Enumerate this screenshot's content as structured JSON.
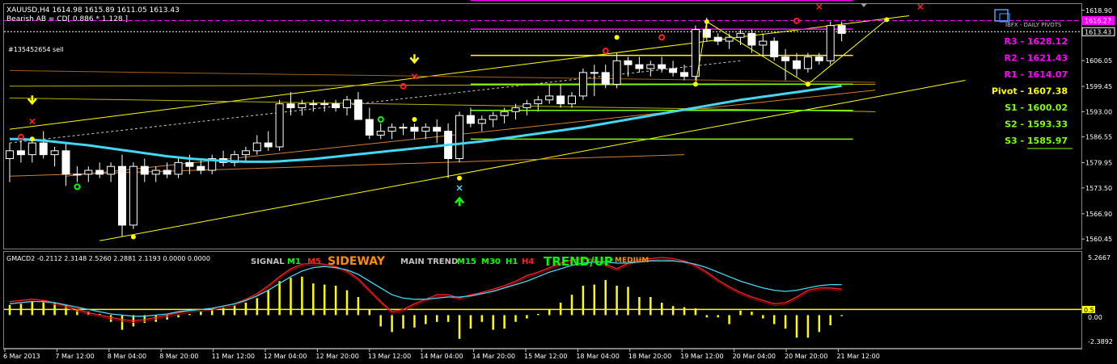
{
  "header": {
    "symbol_line": "XAUUSD,H4  1614.98 1615.89 1611.05 1613.43",
    "pattern_line": "Bearish AB = CD[ 0.886 * 1.128 ]",
    "order_label": "#135452654 sell",
    "pivots_caption": "IBFX - DAILY PIVOTS"
  },
  "pivots": [
    {
      "label": "R3 - 1628.12",
      "value": 1628.12,
      "color": "#ff00ff"
    },
    {
      "label": "R2 - 1621.43",
      "value": 1621.43,
      "color": "#ff00ff"
    },
    {
      "label": "R1 - 1614.07",
      "value": 1614.07,
      "color": "#ff00ff"
    },
    {
      "label": "Pivot - 1607.38",
      "value": 1607.38,
      "color": "#ffff00"
    },
    {
      "label": "S1 - 1600.02",
      "value": 1600.02,
      "color": "#7fff00"
    },
    {
      "label": "S2 - 1593.33",
      "value": 1593.33,
      "color": "#7fff00"
    },
    {
      "label": "S3 - 1585.97",
      "value": 1585.97,
      "color": "#7fff00"
    }
  ],
  "indicator": {
    "name_line": "GMACD2 -0.2112 2.3148 2.5260 2.2881 2.1193 0.0000 0.0000",
    "signal_label": "SIGNAL",
    "m1": "M1",
    "m5": "M5",
    "sideway": "SIDEWAY",
    "main_trend_label": "MAIN TREND",
    "m15": "M15",
    "m30": "M30",
    "h1": "H1",
    "h4": "H4",
    "trend_up": "TREND/UP",
    "medium": "MEDIUM"
  },
  "colors": {
    "bull": "#ffffff",
    "bear": "#ffffff",
    "ema": "#44d7f5",
    "grid": "#555555",
    "histogram": "#ffff00",
    "signal_red": "#ff2020",
    "signal_blue": "#44d7f5"
  },
  "chart_data": [
    {
      "type": "candlestick",
      "symbol": "XAUUSD",
      "timeframe": "H4",
      "ylim": [
        1558.0,
        1620.5
      ],
      "y_ticks": [
        "1618.90",
        "1613.43",
        "1606.05",
        "1599.45",
        "1593.00",
        "1586.55",
        "1579.95",
        "1573.50",
        "1566.90",
        "1560.45"
      ],
      "y_tick_values": [
        1618.9,
        1613.43,
        1606.05,
        1599.45,
        1593.0,
        1586.55,
        1579.95,
        1573.5,
        1566.9,
        1560.45
      ],
      "price_tags": [
        {
          "label": "1616.27",
          "value": 1616.27,
          "color": "#ff00ff"
        },
        {
          "label": "1613.43",
          "value": 1613.43,
          "color": "#ffffff"
        }
      ],
      "x_labels": [
        "6 Mar 2013",
        "7 Mar 12:00",
        "8 Mar 04:00",
        "8 Mar 20:00",
        "11 Mar 12:00",
        "12 Mar 04:00",
        "12 Mar 20:00",
        "13 Mar 12:00",
        "14 Mar 04:00",
        "14 Mar 20:00",
        "15 Mar 12:00",
        "18 Mar 04:00",
        "18 Mar 20:00",
        "19 Mar 12:00",
        "20 Mar 04:00",
        "20 Mar 20:00",
        "21 Mar 12:00"
      ],
      "candles": [
        [
          1581,
          1585,
          1575,
          1583
        ],
        [
          1583,
          1586,
          1580,
          1582
        ],
        [
          1582,
          1586,
          1580,
          1585
        ],
        [
          1585,
          1588,
          1581,
          1582
        ],
        [
          1582,
          1584,
          1579,
          1583
        ],
        [
          1583,
          1585,
          1574,
          1577
        ],
        [
          1577,
          1579,
          1575,
          1577
        ],
        [
          1577,
          1579,
          1575,
          1578
        ],
        [
          1578,
          1580,
          1576,
          1577
        ],
        [
          1577,
          1580,
          1575,
          1579
        ],
        [
          1579,
          1582,
          1561,
          1564
        ],
        [
          1564,
          1580,
          1563,
          1579
        ],
        [
          1579,
          1581,
          1575,
          1577
        ],
        [
          1577,
          1579,
          1575,
          1578
        ],
        [
          1578,
          1580,
          1576,
          1577
        ],
        [
          1577,
          1581,
          1576,
          1580
        ],
        [
          1580,
          1582,
          1577,
          1579
        ],
        [
          1579,
          1581,
          1577,
          1578
        ],
        [
          1578,
          1582,
          1577,
          1581
        ],
        [
          1581,
          1583,
          1579,
          1580
        ],
        [
          1580,
          1583,
          1579,
          1582
        ],
        [
          1582,
          1584,
          1580,
          1583
        ],
        [
          1583,
          1587,
          1582,
          1585
        ],
        [
          1585,
          1588,
          1583,
          1584
        ],
        [
          1584,
          1596,
          1583,
          1595
        ],
        [
          1595,
          1598,
          1592,
          1594
        ],
        [
          1594,
          1596,
          1592,
          1595
        ],
        [
          1595,
          1596,
          1593,
          1595
        ],
        [
          1595,
          1596,
          1593,
          1595
        ],
        [
          1595,
          1596,
          1593,
          1594
        ],
        [
          1594,
          1597,
          1592,
          1596
        ],
        [
          1596,
          1598,
          1591,
          1591
        ],
        [
          1591,
          1594,
          1586,
          1587
        ],
        [
          1587,
          1590,
          1586,
          1588
        ],
        [
          1588,
          1590,
          1586,
          1589
        ],
        [
          1589,
          1590,
          1587,
          1589
        ],
        [
          1589,
          1590,
          1586,
          1588
        ],
        [
          1588,
          1590,
          1586,
          1589
        ],
        [
          1589,
          1591,
          1585,
          1588
        ],
        [
          1588,
          1590,
          1576,
          1581
        ],
        [
          1581,
          1593,
          1580,
          1592
        ],
        [
          1592,
          1594,
          1589,
          1590
        ],
        [
          1590,
          1592,
          1588,
          1591
        ],
        [
          1591,
          1593,
          1589,
          1592
        ],
        [
          1592,
          1594,
          1590,
          1593
        ],
        [
          1593,
          1595,
          1591,
          1594
        ],
        [
          1594,
          1596,
          1592,
          1595
        ],
        [
          1595,
          1597,
          1593,
          1596
        ],
        [
          1596,
          1600,
          1595,
          1597
        ],
        [
          1597,
          1600,
          1594,
          1595
        ],
        [
          1595,
          1598,
          1594,
          1597
        ],
        [
          1597,
          1604,
          1596,
          1603
        ],
        [
          1603,
          1605,
          1597,
          1603
        ],
        [
          1603,
          1605,
          1599,
          1600
        ],
        [
          1600,
          1608,
          1599,
          1606
        ],
        [
          1606,
          1607,
          1602,
          1605
        ],
        [
          1605,
          1607,
          1603,
          1604
        ],
        [
          1604,
          1606,
          1602,
          1605
        ],
        [
          1605,
          1607,
          1603,
          1604
        ],
        [
          1604,
          1606,
          1602,
          1603
        ],
        [
          1603,
          1605,
          1601,
          1602
        ],
        [
          1602,
          1615,
          1601,
          1614
        ],
        [
          1614,
          1617,
          1611,
          1612
        ],
        [
          1612,
          1613,
          1610,
          1611
        ],
        [
          1611,
          1613,
          1609,
          1612
        ],
        [
          1612,
          1614,
          1610,
          1613
        ],
        [
          1613,
          1614,
          1608,
          1610
        ],
        [
          1610,
          1613,
          1607,
          1611
        ],
        [
          1611,
          1612,
          1606,
          1607
        ],
        [
          1607,
          1609,
          1601,
          1606
        ],
        [
          1606,
          1608,
          1602,
          1604
        ],
        [
          1604,
          1608,
          1603,
          1607
        ],
        [
          1607,
          1608,
          1605,
          1606
        ],
        [
          1606,
          1616,
          1605,
          1615
        ],
        [
          1615,
          1616,
          1611,
          1613
        ]
      ],
      "ema_values": [
        1586,
        1586,
        1585.8,
        1585.6,
        1585.3,
        1585,
        1584.7,
        1584.4,
        1584.0,
        1583.6,
        1583.2,
        1582.8,
        1582.4,
        1582.0,
        1581.6,
        1581.3,
        1581.0,
        1580.8,
        1580.6,
        1580.4,
        1580.3,
        1580.2,
        1580.2,
        1580.2,
        1580.3,
        1580.5,
        1580.7,
        1580.9,
        1581.2,
        1581.5,
        1581.8,
        1582.1,
        1582.4,
        1582.7,
        1583.0,
        1583.3,
        1583.6,
        1583.9,
        1584.2,
        1584.5,
        1584.8,
        1585.1,
        1585.4,
        1585.8,
        1586.2,
        1586.6,
        1587.0,
        1587.4,
        1587.8,
        1588.2,
        1588.6,
        1589.0,
        1589.5,
        1590.0,
        1590.5,
        1591.0,
        1591.5,
        1592.0,
        1592.5,
        1593.0,
        1593.5,
        1594.0,
        1594.5,
        1595.0,
        1595.5,
        1596.0,
        1596.4,
        1596.8,
        1597.2,
        1597.6,
        1598.0,
        1598.4,
        1598.8,
        1599.2,
        1599.6
      ],
      "markers": [
        {
          "candle": 1,
          "price": 1586.5,
          "symbol": "o",
          "color": "#ff2020"
        },
        {
          "candle": 2,
          "price": 1590.5,
          "symbol": "x",
          "color": "#ff2020"
        },
        {
          "candle": 2,
          "price": 1595.5,
          "symbol": "arrow-down",
          "color": "#ffff00"
        },
        {
          "candle": 6,
          "price": 1573.8,
          "symbol": "o",
          "color": "#00ff00"
        },
        {
          "candle": 33,
          "price": 1591.0,
          "symbol": "o",
          "color": "#00ff00"
        },
        {
          "candle": 35,
          "price": 1599.5,
          "symbol": "o",
          "color": "#ff2020"
        },
        {
          "candle": 36,
          "price": 1602.0,
          "symbol": "x",
          "color": "#ff2020"
        },
        {
          "candle": 36,
          "price": 1606.0,
          "symbol": "arrow-down",
          "color": "#ffff00"
        },
        {
          "candle": 53,
          "price": 1608.5,
          "symbol": "o",
          "color": "#ff2020"
        },
        {
          "candle": 58,
          "price": 1612.0,
          "symbol": "o",
          "color": "#ff2020"
        },
        {
          "candle": 70,
          "price": 1616.2,
          "symbol": "o",
          "color": "#ff2020"
        },
        {
          "candle": 72,
          "price": 1619.8,
          "symbol": "x",
          "color": "#ff2020"
        },
        {
          "candle": 81,
          "price": 1619.8,
          "symbol": "x",
          "color": "#ff2020"
        },
        {
          "candle": 40,
          "price": 1573.5,
          "symbol": "x",
          "color": "#44d7f5"
        },
        {
          "candle": 40,
          "price": 1570.5,
          "symbol": "arrow-up",
          "color": "#00ff00"
        }
      ]
    },
    {
      "type": "histogram+line",
      "name": "GMACD2",
      "ylim": [
        -2.9,
        5.6
      ],
      "y_ticks": [
        "5.2667",
        "0.5",
        "0.00",
        "-2.3892"
      ],
      "y_tick_values": [
        5.2667,
        0.5,
        0.0,
        -2.3892
      ],
      "histogram": [
        0.9,
        1.0,
        1.2,
        1.3,
        1.1,
        0.9,
        0.5,
        0.3,
        0.1,
        -0.6,
        -1.3,
        -1.0,
        -0.7,
        -0.6,
        -0.4,
        -0.2,
        0.1,
        0.3,
        0.5,
        0.7,
        0.9,
        1.1,
        1.5,
        2.2,
        3.0,
        3.3,
        3.4,
        2.8,
        2.7,
        2.6,
        2.2,
        1.6,
        0.5,
        -1.0,
        -1.5,
        -1.2,
        -1.1,
        -0.8,
        -0.6,
        -0.6,
        -2.1,
        -1.2,
        -0.6,
        -1.3,
        -1.2,
        -0.6,
        -0.3,
        0.1,
        0.5,
        1.1,
        1.8,
        2.6,
        2.7,
        3.1,
        2.6,
        2.5,
        1.6,
        1.6,
        1.1,
        0.8,
        0.7,
        0.6,
        -0.2,
        -0.2,
        -0.8,
        0.4,
        0.3,
        -0.3,
        -0.8,
        -1.2,
        -2.0,
        -2.0,
        -1.5,
        -0.9,
        -0.1
      ],
      "signal_red": [
        1.2,
        1.3,
        1.4,
        1.3,
        1.1,
        0.8,
        0.5,
        0.2,
        0.0,
        -0.2,
        -0.4,
        -0.5,
        -0.4,
        -0.2,
        0.0,
        0.2,
        0.4,
        0.5,
        0.6,
        0.8,
        1.0,
        1.4,
        1.9,
        2.6,
        3.4,
        4.1,
        4.5,
        4.6,
        4.5,
        4.3,
        3.9,
        3.2,
        2.2,
        1.2,
        0.3,
        0.5,
        1.0,
        1.4,
        1.8,
        1.8,
        1.5,
        1.8,
        2.0,
        2.3,
        2.6,
        3.0,
        3.5,
        3.8,
        4.2,
        4.6,
        4.9,
        5.0,
        4.9,
        4.5,
        4.1,
        4.6,
        4.9,
        5.0,
        5.1,
        5.0,
        4.8,
        4.4,
        3.8,
        3.1,
        2.5,
        2.0,
        1.6,
        1.3,
        1.0,
        1.1,
        1.6,
        2.2,
        2.4,
        2.4,
        2.3
      ],
      "signal_blue": [
        1.0,
        1.1,
        1.2,
        1.2,
        1.1,
        0.9,
        0.7,
        0.5,
        0.3,
        0.1,
        0.0,
        -0.1,
        -0.1,
        0.0,
        0.1,
        0.3,
        0.4,
        0.5,
        0.6,
        0.8,
        1.0,
        1.3,
        1.7,
        2.2,
        2.8,
        3.4,
        3.9,
        4.2,
        4.3,
        4.2,
        4.0,
        3.6,
        3.0,
        2.4,
        1.8,
        1.5,
        1.4,
        1.4,
        1.5,
        1.6,
        1.6,
        1.7,
        1.9,
        2.1,
        2.4,
        2.7,
        3.0,
        3.4,
        3.8,
        4.1,
        4.4,
        4.6,
        4.7,
        4.7,
        4.6,
        4.6,
        4.7,
        4.8,
        4.8,
        4.8,
        4.7,
        4.5,
        4.2,
        3.8,
        3.4,
        3.0,
        2.7,
        2.4,
        2.2,
        2.1,
        2.2,
        2.4,
        2.6,
        2.7,
        2.7
      ]
    }
  ]
}
